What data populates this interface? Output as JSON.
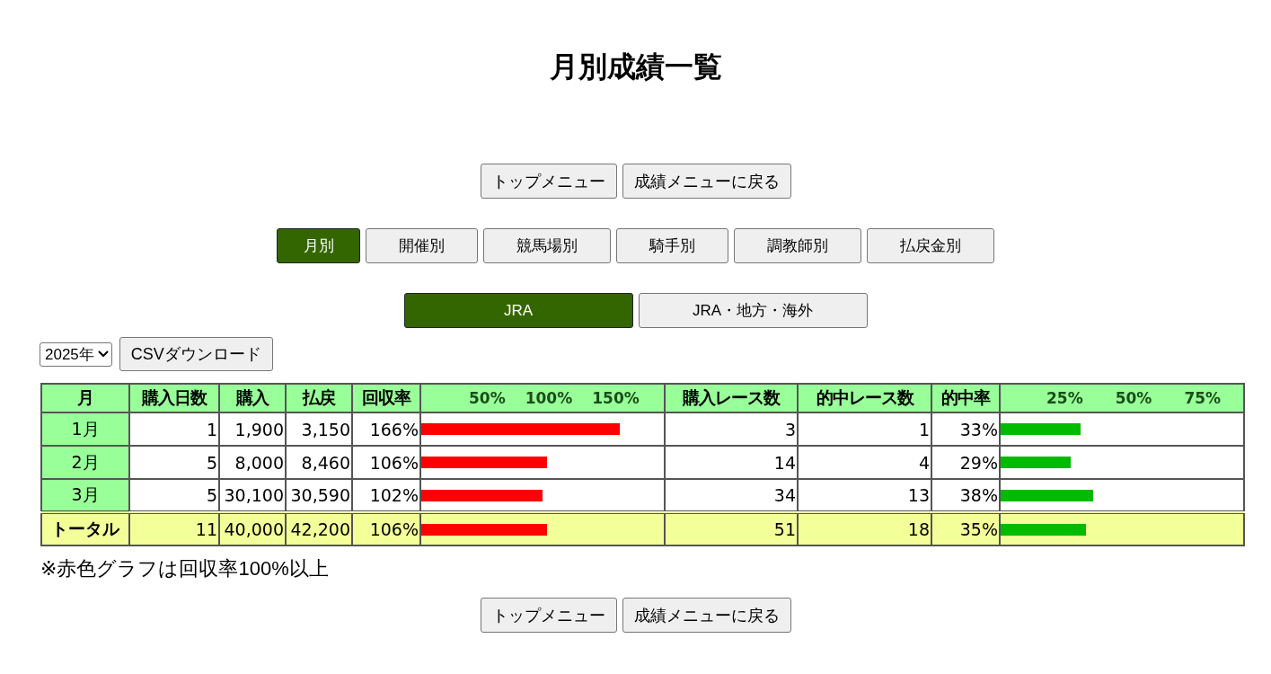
{
  "title": "月別成績一覧",
  "top_buttons": [
    "トップメニュー",
    "成績メニューに戻る"
  ],
  "tabs": [
    {
      "label": "月別",
      "selected": true
    },
    {
      "label": "開催別",
      "selected": false
    },
    {
      "label": "競馬場別",
      "selected": false
    },
    {
      "label": "騎手別",
      "selected": false
    },
    {
      "label": "調教師別",
      "selected": false
    },
    {
      "label": "払戻金別",
      "selected": false
    }
  ],
  "scope_tabs": [
    {
      "label": "JRA",
      "selected": true
    },
    {
      "label": "JRA・地方・海外",
      "selected": false
    }
  ],
  "year_select": {
    "value": "2025年"
  },
  "csv_button": "CSVダウンロード",
  "table": {
    "columns": [
      "月",
      "購入日数",
      "購入",
      "払戻",
      "回収率",
      {
        "scale": [
          "50%",
          "100%",
          "150%"
        ]
      },
      "購入レース数",
      "的中レース数",
      "的中率",
      {
        "scale": [
          "25%",
          "50%",
          "75%"
        ]
      }
    ],
    "rows": [
      {
        "month": "1月",
        "days": "1",
        "purchase": "1,900",
        "payout": "3,150",
        "recovery": "166%",
        "recovery_bar": {
          "level": 0.82
        },
        "races": "3",
        "hits": "1",
        "hit_rate": "33%",
        "hit_bar": {
          "level": 0.33
        },
        "total": false
      },
      {
        "month": "2月",
        "days": "5",
        "purchase": "8,000",
        "payout": "8,460",
        "recovery": "106%",
        "recovery_bar": {
          "level": 0.52
        },
        "races": "14",
        "hits": "4",
        "hit_rate": "29%",
        "hit_bar": {
          "level": 0.29
        },
        "total": false
      },
      {
        "month": "3月",
        "days": "5",
        "purchase": "30,100",
        "payout": "30,590",
        "recovery": "102%",
        "recovery_bar": {
          "level": 0.5
        },
        "races": "34",
        "hits": "13",
        "hit_rate": "38%",
        "hit_bar": {
          "level": 0.38
        },
        "total": false
      },
      {
        "month": "トータル",
        "days": "11",
        "purchase": "40,000",
        "payout": "42,200",
        "recovery": "106%",
        "recovery_bar": {
          "level": 0.52
        },
        "races": "51",
        "hits": "18",
        "hit_rate": "35%",
        "hit_bar": {
          "level": 0.35
        },
        "total": true
      }
    ]
  },
  "note": "※赤色グラフは回収率100%以上",
  "bottom_buttons": [
    "トップメニュー",
    "成績メニューに戻る"
  ]
}
